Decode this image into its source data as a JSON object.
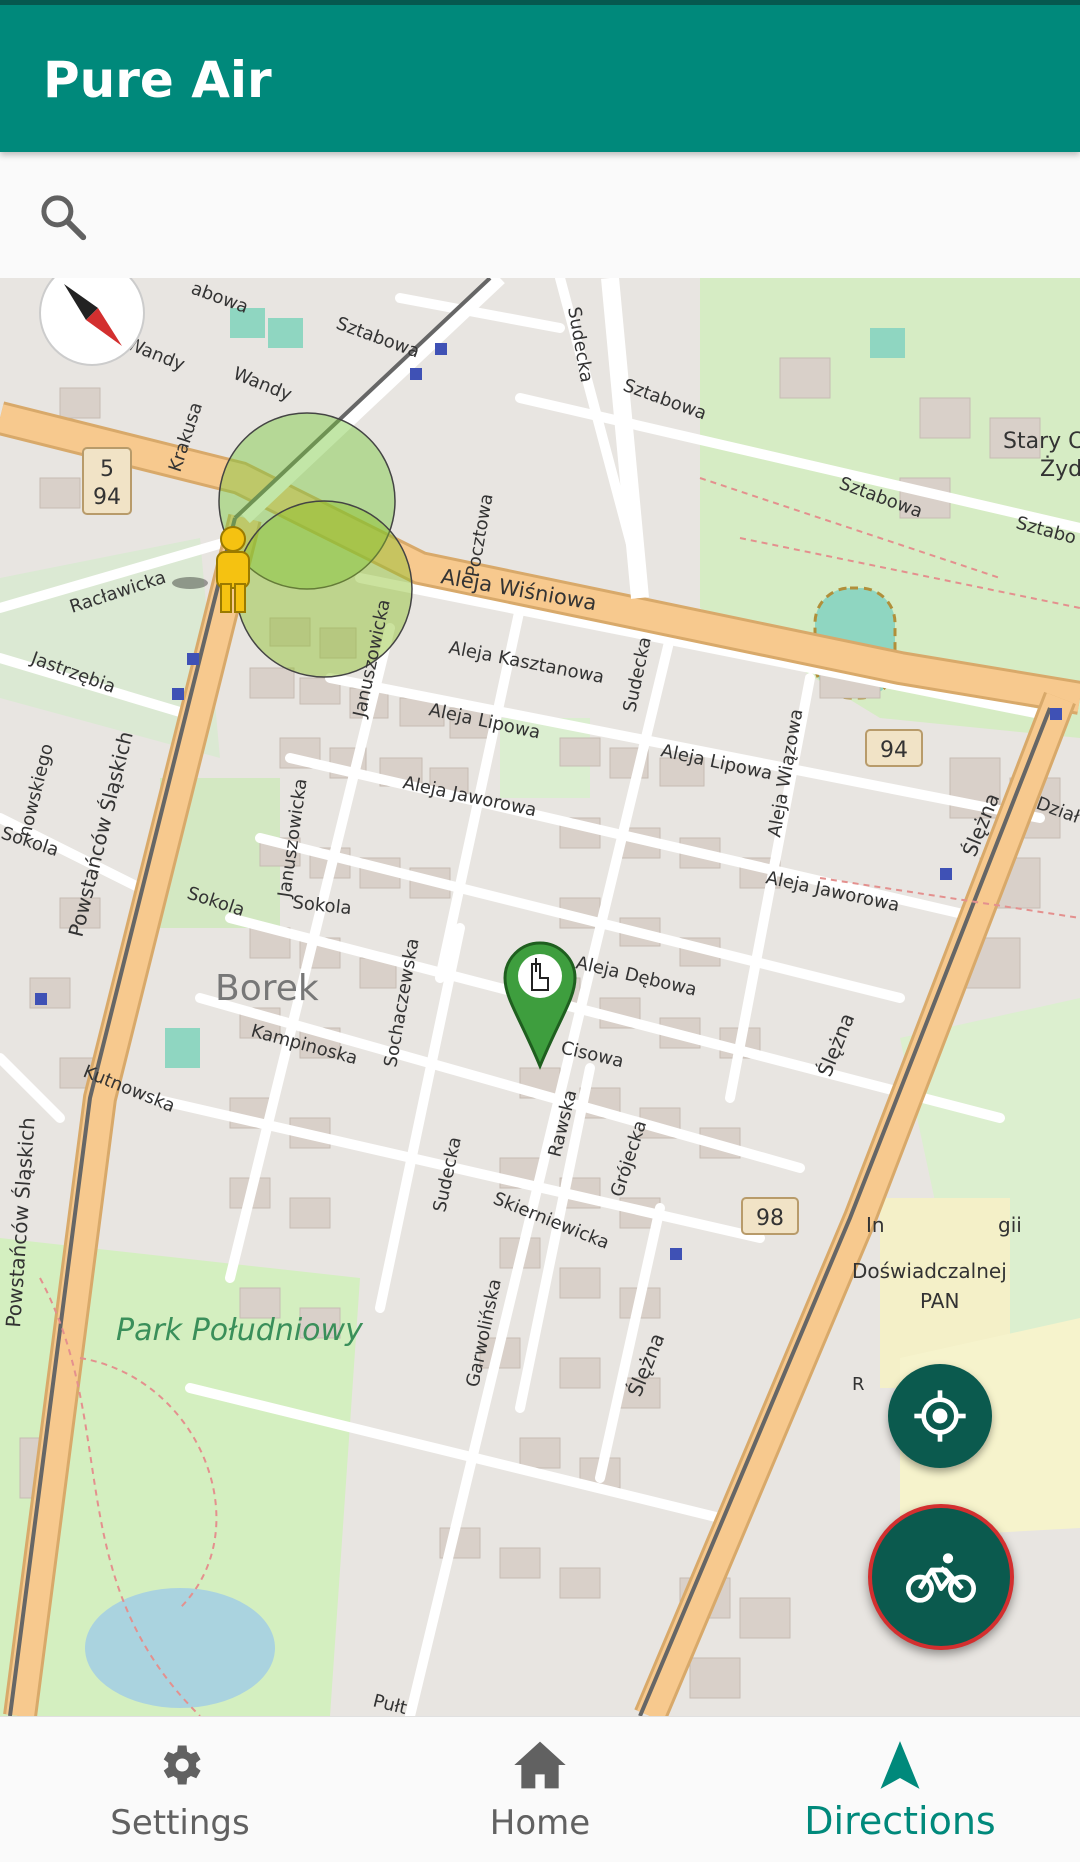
{
  "app_bar": {
    "title": "Pure Air"
  },
  "search": {
    "placeholder": ""
  },
  "map": {
    "labels": {
      "borek": "Borek",
      "park": "Park Południowy",
      "aleja_wisniowa": "Aleja Wiśniowa",
      "aleja_kasztanowa": "Aleja Kasztanowa",
      "aleja_lipowa": "Aleja Lipowa",
      "aleja_lipowa_2": "Aleja Lipowa",
      "aleja_jaworowa": "Aleja Jaworowa",
      "aleja_jaworowa_2": "Aleja Jaworowa",
      "aleja_debowa": "Aleja Dębowa",
      "aleja_wiazowa": "Aleja Wiązowa",
      "sztabowa_1": "Sztabowa",
      "sztabowa_2": "Sztabowa",
      "sztabowa_3": "Sztabowa",
      "sztabowa_4": "Sztabo",
      "sudecka_1": "Sudecka",
      "sudecka_2": "Sudecka",
      "sudecka_3": "Sudecka",
      "powstancow_1": "Powstańców Śląskich",
      "powstancow_2": "Powstańców Śląskich",
      "slezna_1": "Ślężna",
      "slezna_2": "Ślężna",
      "slezna_3": "Ślężna",
      "januszowicka_1": "Januszowicka",
      "januszowicka_2": "Januszowicka",
      "pocztowa": "Pocztowa",
      "krakusa": "Krakusa",
      "wandy_1": "Wandy",
      "wandy_2": "Wandy",
      "raclawicka": "Racławicka",
      "jastrzebia": "Jastrzębia",
      "sokola_1": "Sokola",
      "sokola_2": "Sokola",
      "sokola_3": "Sokola",
      "sochaczewska": "Sochaczewska",
      "kampinoska": "Kampinoska",
      "kutnowska": "Kutnowska",
      "cisowa": "Cisowa",
      "rawska": "Rawska",
      "grojecka": "Grójecka",
      "skierniewicka": "Skierniewicka",
      "garwolinska": "Garwolińska",
      "stary_1": "Stary C",
      "stary_2": "Żyd",
      "dzial": "Dział",
      "instytut_1": "In",
      "instytut_2": "gii",
      "doswiadczalnej": "Doświadczalnej",
      "pan": "PAN",
      "partial_bowa": "abowa",
      "partial_owskiego": "nowskiego",
      "partial_r": "R",
      "partial_pulk": "Pułt",
      "route_5": "5",
      "route_94a": "94",
      "route_94b": "94",
      "route_98": "98"
    }
  },
  "fabs": {
    "locate": {
      "icon": "gps-fixed-icon"
    },
    "route": {
      "icon": "bicycle-icon"
    }
  },
  "bottom_nav": {
    "items": [
      {
        "label": "Settings",
        "icon": "gear-icon"
      },
      {
        "label": "Home",
        "icon": "home-icon"
      },
      {
        "label": "Directions",
        "icon": "navigation-arrow-icon",
        "active": true
      }
    ]
  },
  "colors": {
    "app_bar": "#00897b",
    "fab": "#0b5a4e",
    "fab_ring": "#d32f2f",
    "active_nav": "#00897b",
    "major_road": "#f7c98e",
    "park": "#cdebb0"
  }
}
